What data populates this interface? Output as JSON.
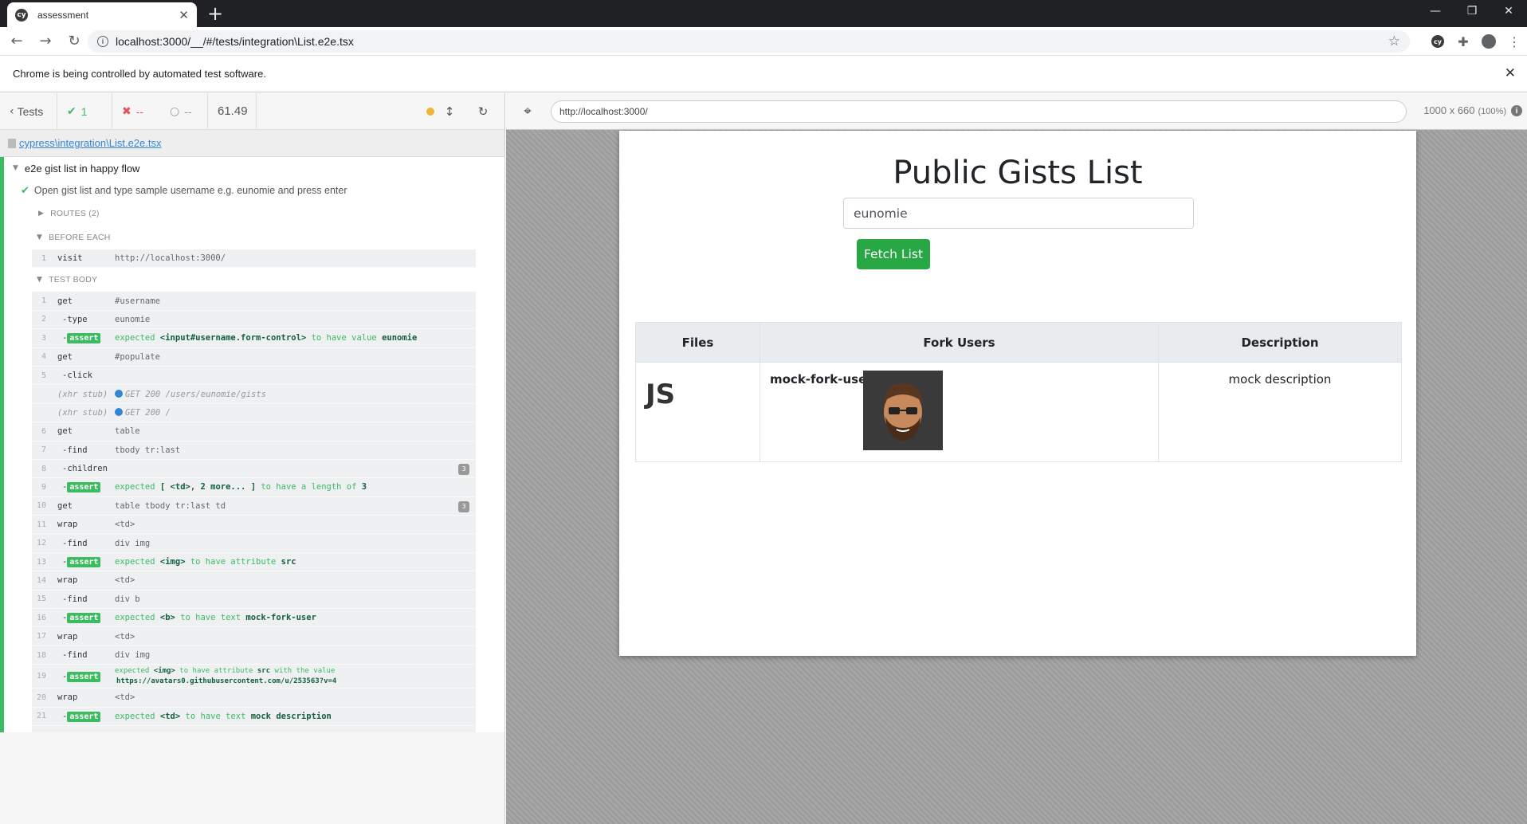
{
  "browser": {
    "tab_title": "assessment",
    "tab_favicon": "cy",
    "url": "localhost:3000/__/#/tests/integration\\List.e2e.tsx",
    "infobar_text": "Chrome is being controlled by automated test software."
  },
  "reporter": {
    "tests_label": "Tests",
    "passed": "1",
    "failed": "--",
    "pending": "--",
    "duration": "61.49",
    "spec_file": "cypress\\integration\\List.e2e.tsx",
    "suite_title": "e2e gist list in happy flow",
    "test_title": "Open gist list and type sample username e.g. eunomie and press enter",
    "routes_label": "ROUTES (2)",
    "before_each_label": "BEFORE EACH",
    "test_body_label": "TEST BODY",
    "before_each": [
      {
        "num": "1",
        "name": "visit",
        "msg": "http://localhost:3000/"
      }
    ],
    "commands": [
      {
        "num": "1",
        "name": "get",
        "msg": "#username"
      },
      {
        "num": "2",
        "name": "-type",
        "msg": "eunomie"
      },
      {
        "num": "3",
        "name": "-assert",
        "exp": "expected",
        "a": "<input#username.form-control>",
        "mid": "to have value",
        "b": "eunomie"
      },
      {
        "num": "4",
        "name": "get",
        "msg": "#populate"
      },
      {
        "num": "5",
        "name": "-click",
        "msg": ""
      },
      {
        "num": "",
        "name": "(xhr stub)",
        "msg": "GET 200 /users/eunomie/gists"
      },
      {
        "num": "",
        "name": "(xhr stub)",
        "msg": "GET 200 /"
      },
      {
        "num": "6",
        "name": "get",
        "msg": "table"
      },
      {
        "num": "7",
        "name": "-find",
        "msg": "tbody tr:last"
      },
      {
        "num": "8",
        "name": "-children",
        "msg": "",
        "badge": "3"
      },
      {
        "num": "9",
        "name": "-assert",
        "exp": "expected",
        "a": "[ <td>, 2 more... ]",
        "mid": "to have a length of",
        "b": "3"
      },
      {
        "num": "10",
        "name": "get",
        "msg": "table tbody tr:last td",
        "badge": "3"
      },
      {
        "num": "11",
        "name": "wrap",
        "msg": "<td>"
      },
      {
        "num": "12",
        "name": "-find",
        "msg": "div img"
      },
      {
        "num": "13",
        "name": "-assert",
        "exp": "expected",
        "a": "<img>",
        "mid": "to have attribute",
        "b": "src"
      },
      {
        "num": "14",
        "name": "wrap",
        "msg": "<td>"
      },
      {
        "num": "15",
        "name": "-find",
        "msg": "div b"
      },
      {
        "num": "16",
        "name": "-assert",
        "exp": "expected",
        "a": "<b>",
        "mid": "to have text",
        "b": "mock-fork-user"
      },
      {
        "num": "17",
        "name": "wrap",
        "msg": "<td>"
      },
      {
        "num": "18",
        "name": "-find",
        "msg": "div img"
      },
      {
        "num": "19",
        "name": "-assert",
        "exp": "expected",
        "a": "<img>",
        "mid": "to have attribute",
        "b": "src",
        "tail": "with the value",
        "line2": "https://avatars0.githubusercontent.com/u/253563?v=4"
      },
      {
        "num": "20",
        "name": "wrap",
        "msg": "<td>"
      },
      {
        "num": "21",
        "name": "-assert",
        "exp": "expected",
        "a": "<td>",
        "mid": "to have text",
        "b": "mock description"
      }
    ],
    "assert_tag": "assert"
  },
  "aut": {
    "url": "http://localhost:3000/",
    "size": "1000 x 660",
    "scale": "(100%)"
  },
  "app": {
    "title": "Public Gists List",
    "username_value": "eunomie",
    "fetch_button": "Fetch List",
    "table_headers": [
      "Files",
      "Fork Users",
      "Description"
    ],
    "row": {
      "file": "JS",
      "fork_user": "mock-fork-user",
      "description": "mock description"
    }
  },
  "colors": {
    "pass": "#3cbb62",
    "fail": "#e94f5f",
    "link": "#3386d4",
    "button": "#28a745"
  }
}
